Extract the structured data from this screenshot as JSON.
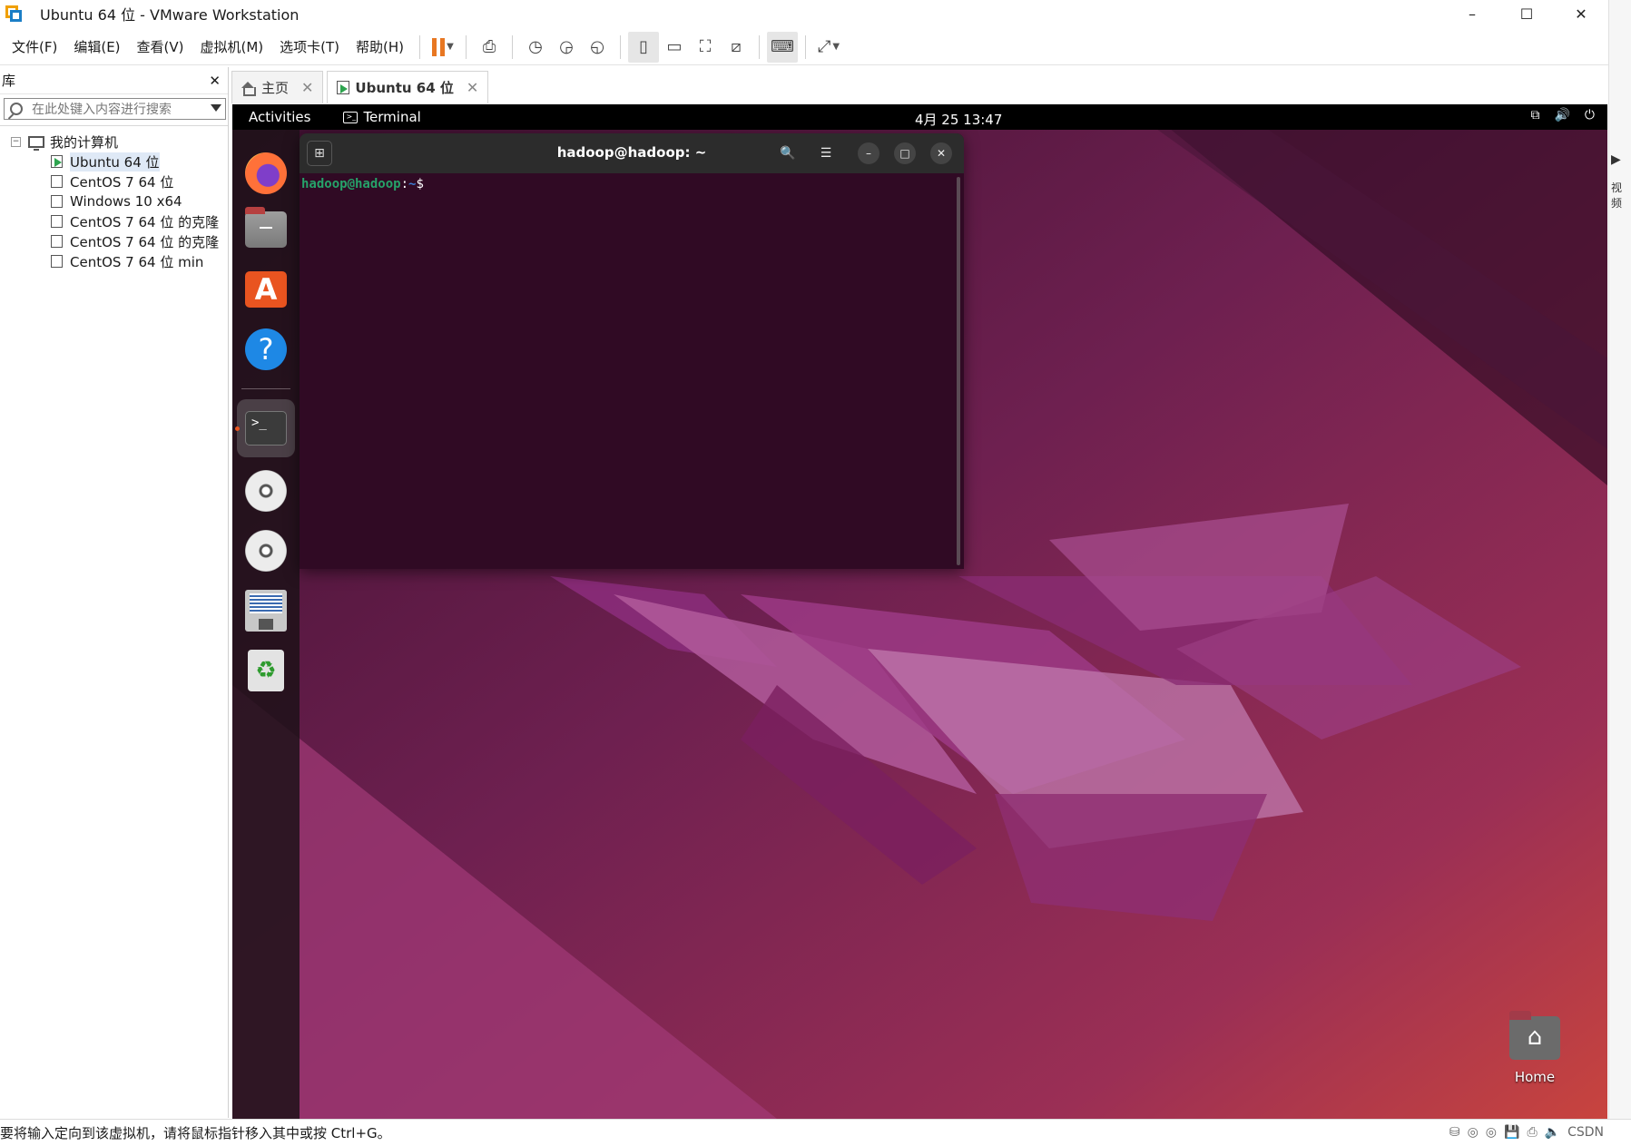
{
  "window": {
    "title": "Ubuntu 64 位 - VMware Workstation",
    "controls": [
      "–",
      "☐",
      "✕"
    ]
  },
  "menubar": {
    "items": [
      "文件(F)",
      "编辑(E)",
      "查看(V)",
      "虚拟机(M)",
      "选项卡(T)",
      "帮助(H)"
    ],
    "accent": "#e87722"
  },
  "library": {
    "title": "库",
    "close": "✕",
    "search_placeholder": "在此处键入内容进行搜索",
    "root_label": "我的计算机",
    "items": [
      {
        "label": "Ubuntu 64 位",
        "running": true
      },
      {
        "label": "CentOS 7 64 位",
        "running": false
      },
      {
        "label": "Windows 10 x64",
        "running": false
      },
      {
        "label": "CentOS 7 64 位 的克隆",
        "running": false
      },
      {
        "label": "CentOS 7 64 位 的克隆",
        "running": false
      },
      {
        "label": "CentOS 7 64 位 min",
        "running": false
      }
    ]
  },
  "tabs": [
    {
      "label": "主页",
      "close": "✕"
    },
    {
      "label": "Ubuntu 64 位",
      "close": "✕"
    }
  ],
  "ubuntu": {
    "activities": "Activities",
    "app_name": "Terminal",
    "clock": "4月 25  13:47",
    "sys_icons": [
      "network-icon",
      "volume-icon",
      "power-icon"
    ],
    "dock_apps": [
      "firefox-icon",
      "files-icon",
      "app-center-icon",
      "help-icon",
      "terminal-icon",
      "disc-icon",
      "disc-icon",
      "text-editor-icon",
      "trash-icon"
    ],
    "home_label": "Home",
    "accent": "#e95420"
  },
  "terminal": {
    "title": "hadoop@hadoop: ~",
    "prompt_user": "hadoop@hadoop",
    "prompt_sep": ":",
    "prompt_path": "~",
    "prompt_sym": "$"
  },
  "statusbar": {
    "message": "要将输入定向到该虚拟机，请将鼠标指针移入其中或按 Ctrl+G。",
    "right_text": "CSDN"
  },
  "right_strip": {
    "label": "视频"
  }
}
